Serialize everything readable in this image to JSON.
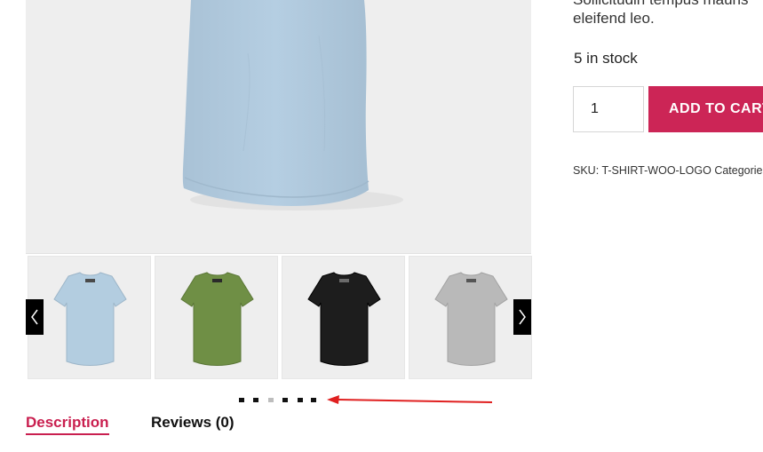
{
  "description": {
    "line1": "Sollicitudin tempus mauris",
    "line2": "eleifend leo."
  },
  "stock": {
    "text": "5 in stock"
  },
  "cart": {
    "quantity": "1",
    "add_label": "ADD TO CART"
  },
  "meta": {
    "sku_label": "SKU:",
    "sku_value": "T-SHIRT-WOO-LOGO",
    "categories_label": "Categories"
  },
  "gallery": {
    "main_shirt_color": "#b3cde0",
    "thumbnails": [
      {
        "name": "blue",
        "color": "#b3cde0"
      },
      {
        "name": "green",
        "color": "#6f8f45"
      },
      {
        "name": "black",
        "color": "#1d1d1d"
      },
      {
        "name": "grey",
        "color": "#b9b9b9"
      }
    ],
    "prev_icon": "chevron-left-icon",
    "next_icon": "chevron-right-icon",
    "dots_count": 6,
    "active_dot": 2
  },
  "tabs": [
    {
      "label": "Description",
      "active": true
    },
    {
      "label": "Reviews (0)",
      "active": false
    }
  ],
  "colors": {
    "accent": "#cc2556",
    "annotation_arrow": "#e02020"
  }
}
